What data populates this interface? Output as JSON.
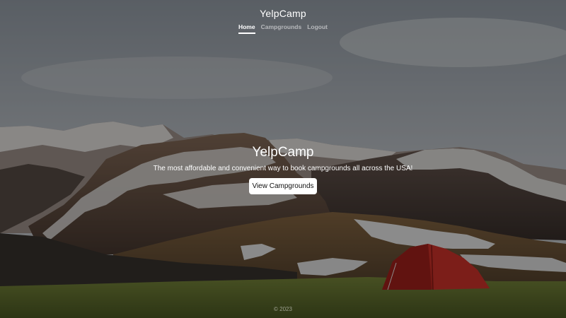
{
  "header": {
    "brand": "YelpCamp",
    "nav": [
      {
        "label": "Home",
        "active": true
      },
      {
        "label": "Campgrounds",
        "active": false
      },
      {
        "label": "Logout",
        "active": false
      }
    ]
  },
  "hero": {
    "title": "YelpCamp",
    "subtitle": "The most affordable and convenient way to book campgrounds all across the USA!",
    "button_label": "View Campgrounds"
  },
  "footer": {
    "text": "© 2023"
  },
  "colors": {
    "text": "#ffffff",
    "button_bg": "#ffffff",
    "tent": "#c62b24"
  }
}
